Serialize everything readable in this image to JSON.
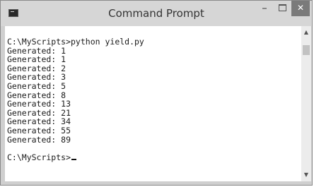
{
  "window": {
    "title": "Command Prompt",
    "minimize_glyph": "–",
    "close_glyph": "✕"
  },
  "console": {
    "lines": [
      "C:\\MyScripts>python yield.py",
      "Generated: 1",
      "Generated: 1",
      "Generated: 2",
      "Generated: 3",
      "Generated: 5",
      "Generated: 8",
      "Generated: 13",
      "Generated: 21",
      "Generated: 34",
      "Generated: 55",
      "Generated: 89",
      "",
      "C:\\MyScripts>"
    ]
  },
  "scrollbar": {
    "up_glyph": "▲",
    "down_glyph": "▼"
  },
  "colors": {
    "titlebar": "#d6d6d6",
    "close_button": "#7a7a7a",
    "console_background": "#ffffff",
    "console_text": "#1a1a1a"
  }
}
